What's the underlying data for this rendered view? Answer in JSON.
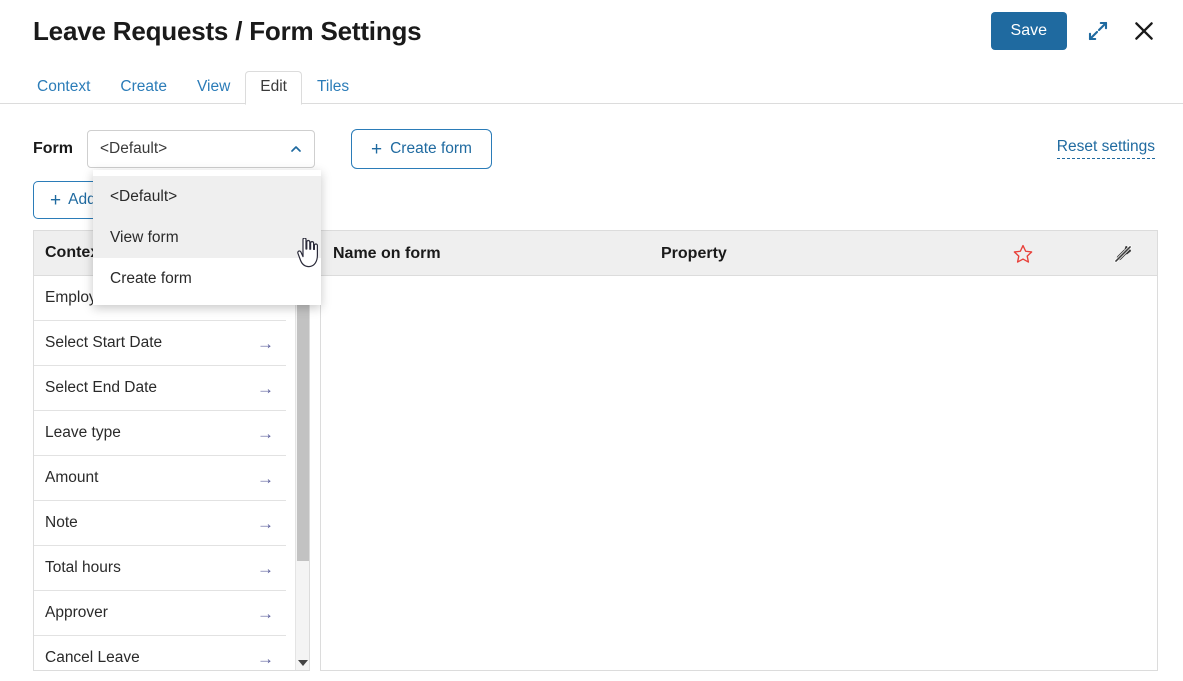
{
  "header": {
    "title": "Leave Requests / Form Settings",
    "save_label": "Save",
    "expand_icon": "expand-icon",
    "close_icon": "close-icon"
  },
  "tabs": [
    {
      "label": "Context",
      "active": false
    },
    {
      "label": "Create",
      "active": false
    },
    {
      "label": "View",
      "active": false
    },
    {
      "label": "Edit",
      "active": true
    },
    {
      "label": "Tiles",
      "active": false
    }
  ],
  "form_row": {
    "label": "Form",
    "select_value": "<Default>",
    "chevron_icon": "chevron-up-icon",
    "create_form_label": "Create form",
    "plus": "+",
    "reset_label": "Reset settings"
  },
  "add_button": {
    "plus": "+",
    "label": "Add"
  },
  "dropdown": {
    "open": true,
    "options": [
      {
        "label": "<Default>",
        "highlighted": true
      },
      {
        "label": "View form",
        "highlighted": true
      },
      {
        "label": "Create form",
        "highlighted": false
      }
    ]
  },
  "left_panel": {
    "header": "Context",
    "arrow_glyph": "→",
    "items": [
      {
        "label": "Employee"
      },
      {
        "label": "Select Start Date"
      },
      {
        "label": "Select End Date"
      },
      {
        "label": "Leave type"
      },
      {
        "label": "Amount"
      },
      {
        "label": "Note"
      },
      {
        "label": "Total hours"
      },
      {
        "label": "Approver"
      },
      {
        "label": "Cancel Leave"
      }
    ]
  },
  "table": {
    "columns": [
      {
        "label": "Name on form"
      },
      {
        "label": "Property"
      }
    ],
    "star_icon": "star-icon",
    "pin_off_icon": "pin-off-icon",
    "rows": []
  },
  "colors": {
    "accent_blue": "#1f6aa0",
    "link_blue": "#2b7cb8",
    "star_red": "#e8413a",
    "header_gray": "#efefef",
    "border_gray": "#dcdcdc"
  }
}
